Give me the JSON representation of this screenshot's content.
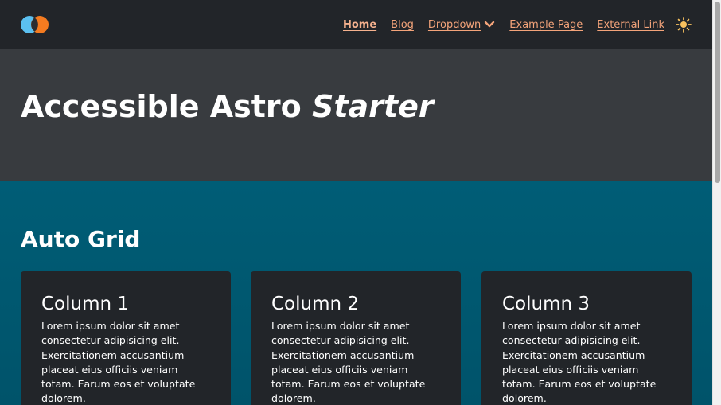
{
  "header": {
    "logo_icon": "two-circles-logo",
    "nav": [
      {
        "label": "Home",
        "active": true
      },
      {
        "label": "Blog"
      },
      {
        "label": "Dropdown",
        "has_chevron": true
      },
      {
        "label": "Example Page"
      },
      {
        "label": "External Link"
      }
    ],
    "theme_toggle_icon": "sun-icon"
  },
  "hero": {
    "title_main": "Accessible Astro",
    "title_emphasis": "Starter"
  },
  "section": {
    "heading": "Auto Grid",
    "cards": [
      {
        "title": "Column 1",
        "body": "Lorem ipsum dolor sit amet consectetur adipisicing elit. Exercitationem accusantium placeat eius officiis veniam totam. Earum eos et voluptate dolorem."
      },
      {
        "title": "Column 2",
        "body": "Lorem ipsum dolor sit amet consectetur adipisicing elit. Exercitationem accusantium placeat eius officiis veniam totam. Earum eos et voluptate dolorem."
      },
      {
        "title": "Column 3",
        "body": "Lorem ipsum dolor sit amet consectetur adipisicing elit. Exercitationem accusantium placeat eius officiis veniam totam. Earum eos et voluptate dolorem."
      }
    ]
  },
  "colors": {
    "header_bg": "#222529",
    "hero_bg": "#383b3f",
    "section_bg": "#005770",
    "card_bg": "#222529",
    "link": "#f4a47a",
    "logo_blue": "#5bc0f0",
    "logo_orange": "#f47b20"
  }
}
